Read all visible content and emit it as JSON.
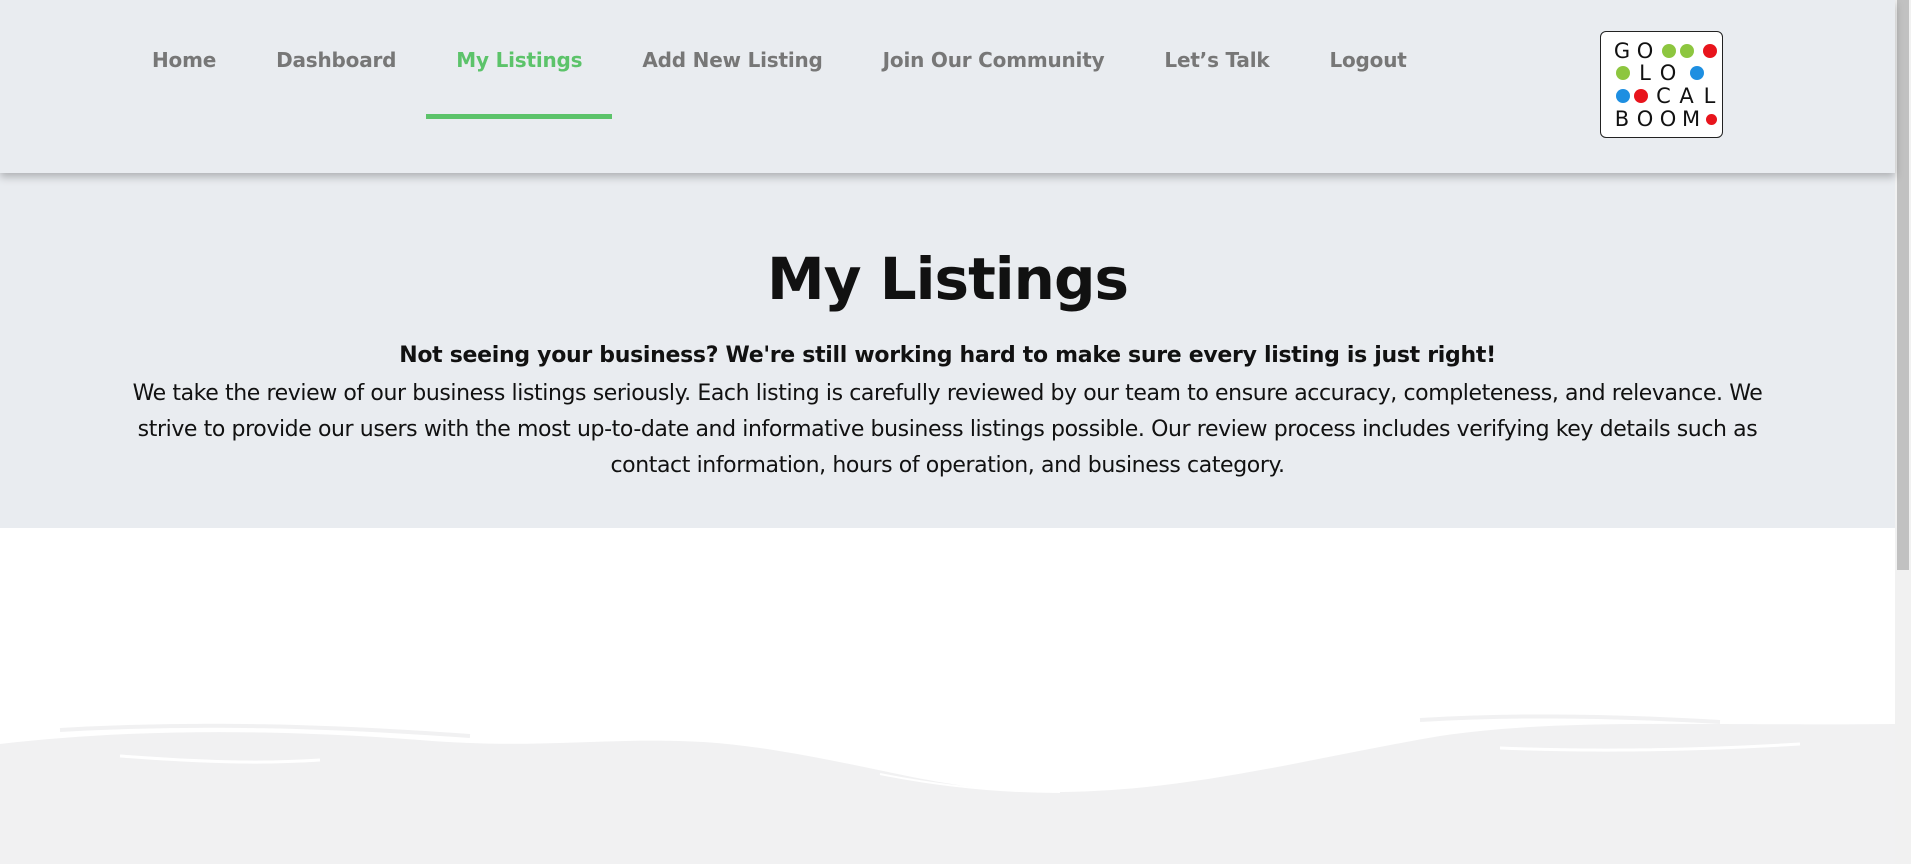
{
  "nav": {
    "items": [
      {
        "label": "Home"
      },
      {
        "label": "Dashboard"
      },
      {
        "label": "My Listings",
        "active": true
      },
      {
        "label": "Add New Listing"
      },
      {
        "label": "Join Our Community"
      },
      {
        "label": "Let’s Talk"
      },
      {
        "label": "Logout"
      }
    ],
    "active_color": "#5cc36a",
    "text_color": "#777777"
  },
  "logo": {
    "rows": [
      "GO",
      "LO",
      "CAL",
      "BOOM"
    ],
    "dot_colors": {
      "green": "#8dc63f",
      "red": "#e8141c",
      "blue": "#1e8fe1"
    }
  },
  "hero": {
    "title": "My Listings",
    "lead": "Not seeing your business? We're still working hard to make sure every listing is just right!",
    "body": "We take the review of our business listings seriously. Each listing is carefully reviewed by our team to ensure accuracy, completeness, and relevance. We strive to provide our users with the most up-to-date and informative business listings possible. Our review process includes verifying key details such as contact in­formation, hours of operation, and business category."
  },
  "colors": {
    "header_bg": "#e9ecf0",
    "wave": "#f1f1f2"
  }
}
